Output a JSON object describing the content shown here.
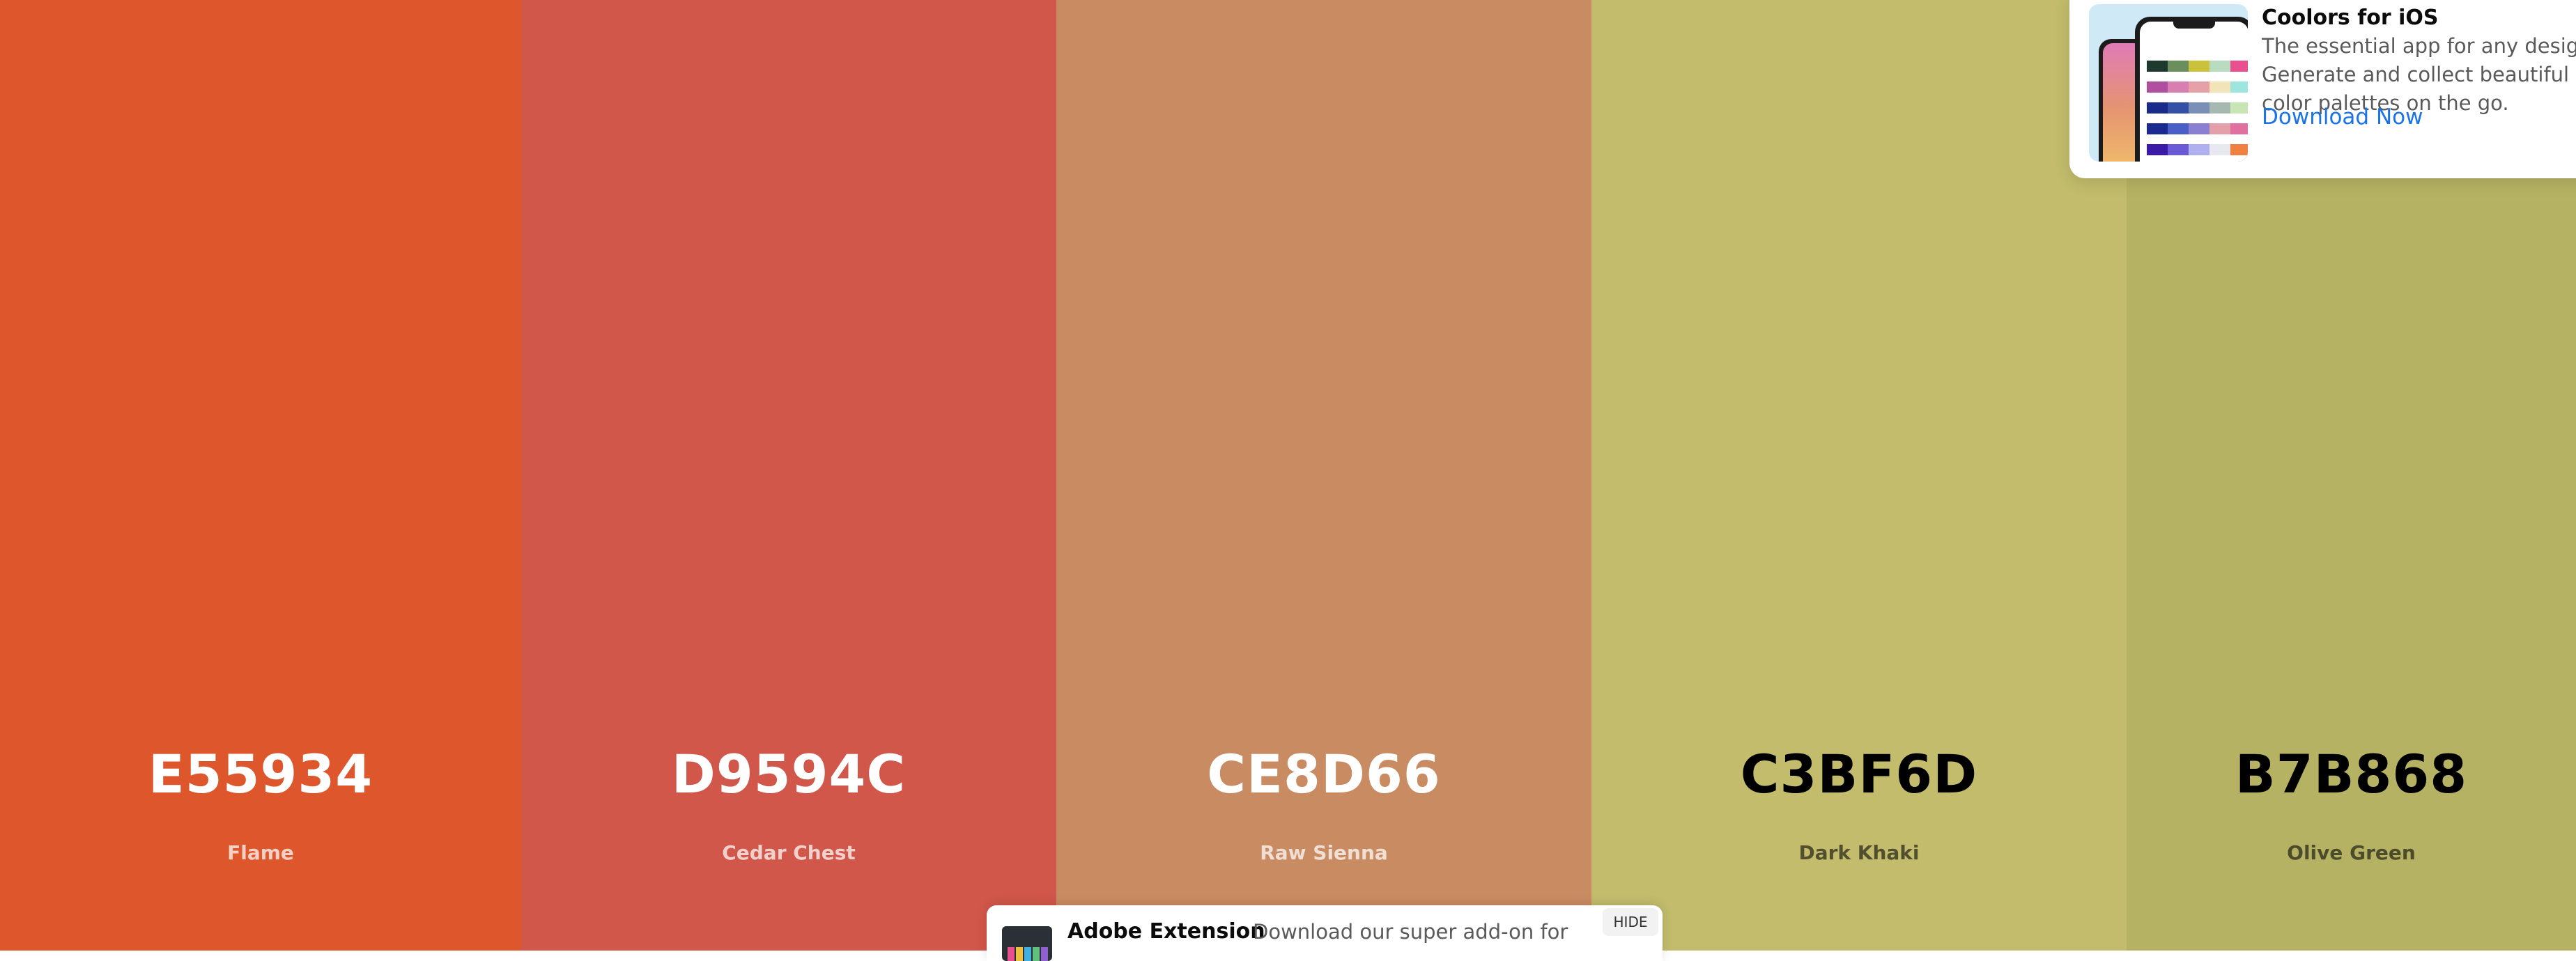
{
  "palette": {
    "swatches": [
      {
        "hex": "E55934",
        "name": "Flame",
        "color": "#DE572C",
        "tone": "light"
      },
      {
        "hex": "D9594C",
        "name": "Cedar Chest",
        "color": "#D1574A",
        "tone": "light"
      },
      {
        "hex": "CE8D66",
        "name": "Raw Sienna",
        "color": "#C98B62",
        "tone": "light"
      },
      {
        "hex": "C3BF6D",
        "name": "Dark Khaki",
        "color": "#C2BC6C",
        "tone": "dark"
      },
      {
        "hex": "B7B868",
        "name": "Olive Green",
        "color": "#B6B264",
        "tone": "dark"
      }
    ]
  },
  "promo": {
    "title": "Coolors for iOS",
    "description_lines": [
      "The essential app for any designer.",
      "Generate and collect beautiful",
      "color palettes on the go."
    ],
    "cta": "Download Now",
    "thumb_palette_rows": [
      [
        "#1f3a2c",
        "#6a8f5c",
        "#c9c23a",
        "#b9dcc0",
        "#e8508f"
      ],
      [
        "#b04fa0",
        "#d77fb0",
        "#e6a0a8",
        "#f2e3b8",
        "#9de6e0"
      ],
      [
        "#1a2a8a",
        "#3450a6",
        "#7a8fb8",
        "#a6b9b0",
        "#c8e6b4"
      ],
      [
        "#1b2a8f",
        "#4a5fc6",
        "#8a7fd0",
        "#e4a0a8",
        "#e070a0"
      ],
      [
        "#3c1aa8",
        "#6a5ad8",
        "#b0b0f0",
        "#e8e8f0",
        "#f08040"
      ]
    ]
  },
  "adobe": {
    "title": "Adobe Extension",
    "description": "Download our super add-on for",
    "hide_label": "HIDE"
  }
}
